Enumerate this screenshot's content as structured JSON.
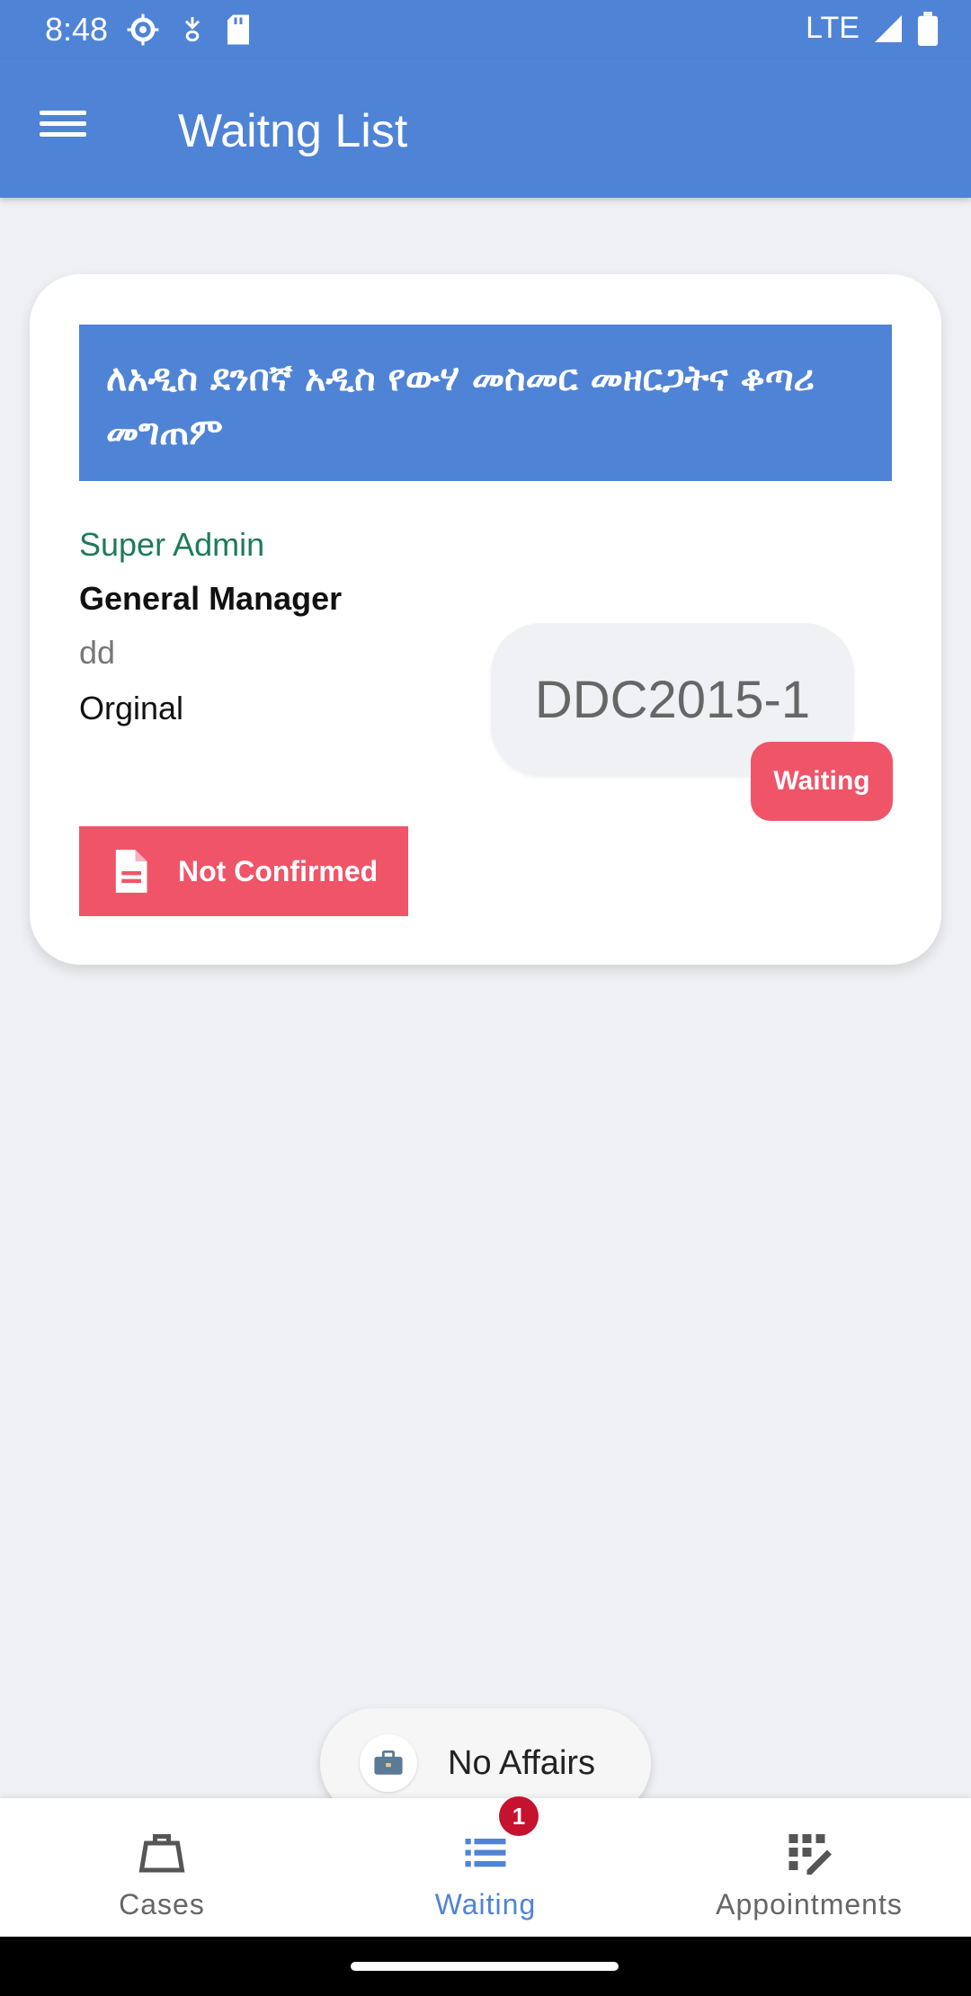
{
  "status_bar": {
    "time": "8:48",
    "network": "LTE"
  },
  "app_bar": {
    "title": "Waitng List"
  },
  "card": {
    "title": "ለአዲስ ደንበኛ አዲስ የውሃ መስመር መዘርጋትና ቆጣሪ መግጠም",
    "organization": "Super Admin",
    "role": "General Manager",
    "code": "dd",
    "type": "Orginal",
    "reference": "DDC2015-1",
    "status": "Waiting",
    "confirm_label": "Not Confirmed"
  },
  "toast": {
    "text": "No Affairs"
  },
  "bottom_nav": {
    "items": [
      {
        "label": "Cases",
        "icon": "briefcase-icon",
        "active": false
      },
      {
        "label": "Waiting",
        "icon": "list-icon",
        "active": true,
        "badge": "1"
      },
      {
        "label": "Appointments",
        "icon": "appointments-icon",
        "active": false
      }
    ]
  },
  "colors": {
    "primary": "#4f83d6",
    "accent": "#f05468",
    "org_text": "#1f7a5c",
    "badge": "#c4122f"
  }
}
